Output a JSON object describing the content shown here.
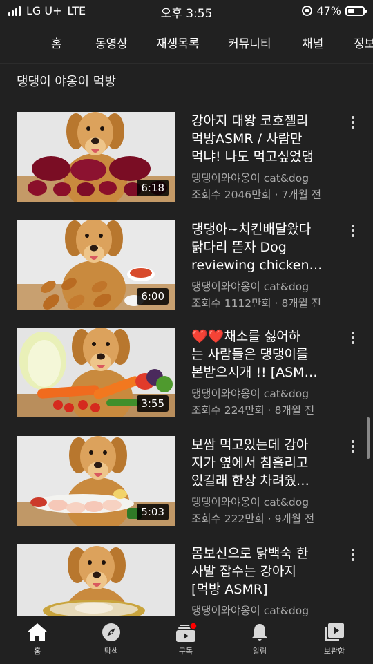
{
  "status_bar": {
    "carrier": "LG U+",
    "network": "LTE",
    "time": "오후 3:55",
    "battery": "47%",
    "battery_level": 0.47
  },
  "tabs": [
    {
      "label": "홈",
      "active": true
    },
    {
      "label": "동영상"
    },
    {
      "label": "재생목록"
    },
    {
      "label": "커뮤니티"
    },
    {
      "label": "채널"
    },
    {
      "label": "정보"
    }
  ],
  "section": {
    "title": "댕댕이 야옹이 먹방"
  },
  "videos": [
    {
      "title": "강아지 대왕 코호젤리\n먹방ASMR / 사람만\n먹냐! 나도 먹고싶었댕",
      "channel": "댕댕이와야옹이 cat&dog",
      "meta": "조회수 2046만회 · 7개월 전",
      "duration": "6:18"
    },
    {
      "title": "댕댕아~치킨배달왔다\n닭다리 뜯자  Dog\nreviewing chicken…",
      "channel": "댕댕이와야옹이 cat&dog",
      "meta": "조회수 1112만회 · 8개월 전",
      "duration": "6:00"
    },
    {
      "title": "❤️❤️채소를 싫어하\n는 사람들은 댕댕이를\n본받으시개 !! [ASM…",
      "channel": "댕댕이와야옹이 cat&dog",
      "meta": "조회수 224만회 · 8개월 전",
      "duration": "3:55"
    },
    {
      "title": "보쌈 먹고있는데 강아\n지가 옆에서 침흘리고\n있길래 한상 차려줬…",
      "channel": "댕댕이와야옹이 cat&dog",
      "meta": "조회수 222만회 · 9개월 전",
      "duration": "5:03"
    },
    {
      "title": "몸보신으로 닭백숙 한\n사발 잡수는 강아지\n[먹방 ASMR]",
      "channel": "댕댕이와야옹이 cat&dog",
      "meta": "",
      "duration": ""
    }
  ],
  "bottom_nav": [
    {
      "label": "홈",
      "icon": "home-icon",
      "active": true
    },
    {
      "label": "탐색",
      "icon": "compass-icon"
    },
    {
      "label": "구독",
      "icon": "subscriptions-icon",
      "badge": true
    },
    {
      "label": "알림",
      "icon": "bell-icon"
    },
    {
      "label": "보관함",
      "icon": "library-icon"
    }
  ],
  "colors": {
    "background": "#212121",
    "secondary_text": "#aaaaaa",
    "badge": "#ff0000"
  }
}
